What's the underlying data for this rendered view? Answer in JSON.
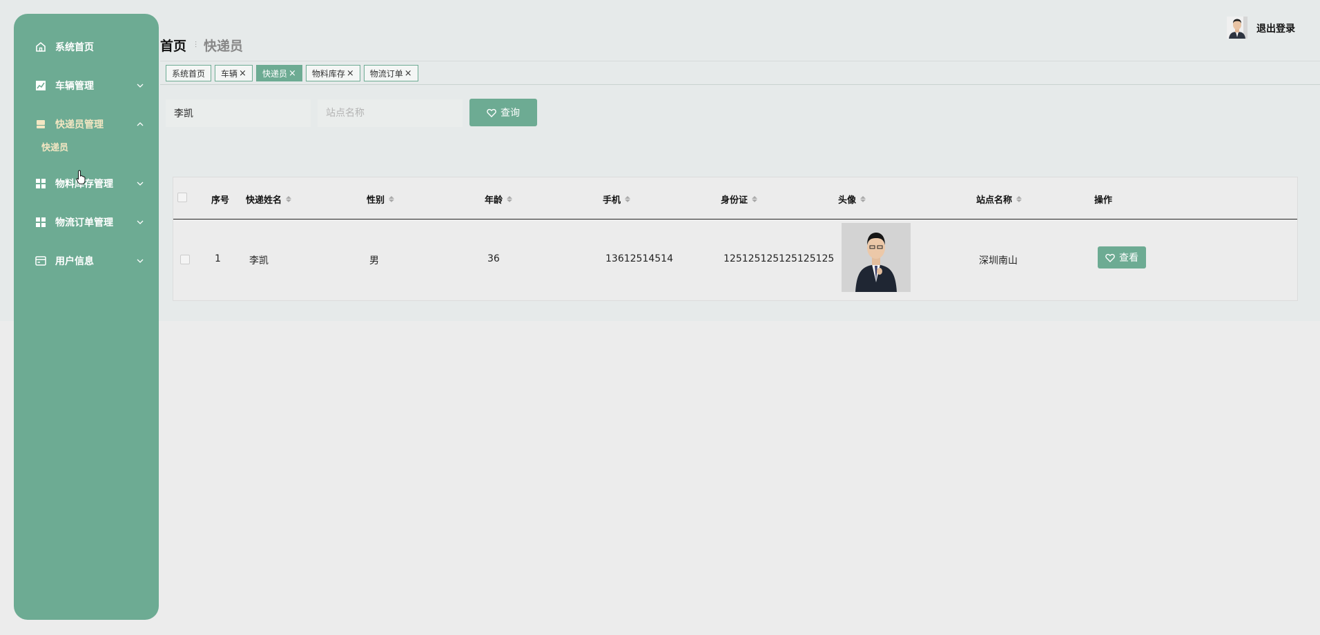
{
  "sidebar": {
    "items": [
      {
        "label": "系统首页",
        "icon": "home-icon"
      },
      {
        "label": "车辆管理",
        "icon": "chart-icon"
      },
      {
        "label": "快递员管理",
        "icon": "courier-icon"
      },
      {
        "label": "物料库存管理",
        "icon": "grid-icon"
      },
      {
        "label": "物流订单管理",
        "icon": "grid-icon"
      },
      {
        "label": "用户信息",
        "icon": "card-icon"
      }
    ],
    "sub_item": "快递员"
  },
  "header": {
    "breadcrumb_home": "首页",
    "breadcrumb_current": "快递员",
    "logout": "退出登录"
  },
  "tags": [
    {
      "label": "系统首页",
      "closable": false
    },
    {
      "label": "车辆",
      "closable": true
    },
    {
      "label": "快递员",
      "closable": true
    },
    {
      "label": "物料库存",
      "closable": true
    },
    {
      "label": "物流订单",
      "closable": true
    }
  ],
  "tag_close": "×",
  "search": {
    "name_value": "李凯",
    "station_placeholder": "站点名称",
    "button": "查询"
  },
  "table": {
    "columns": [
      "序号",
      "快递姓名",
      "性别",
      "年龄",
      "手机",
      "身份证",
      "头像",
      "站点名称",
      "操作"
    ],
    "rows": [
      {
        "index": "1",
        "name": "李凯",
        "gender": "男",
        "age": "36",
        "phone": "13612514514",
        "id_card": "125125125125125125",
        "station": "深圳南山",
        "action": "查看"
      }
    ]
  },
  "colors": {
    "accent": "#6dab93",
    "active_text": "#f3e6c2"
  }
}
